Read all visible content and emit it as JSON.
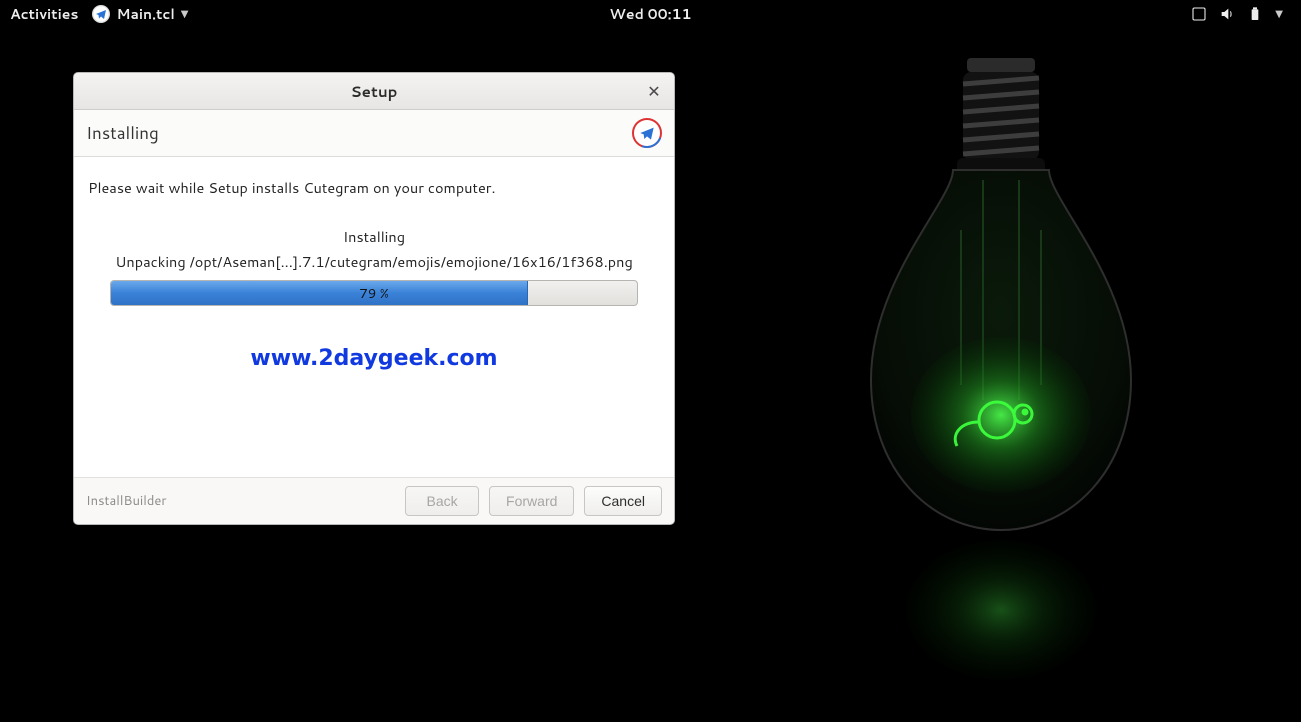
{
  "topbar": {
    "activities": "Activities",
    "app_name": "Main.tcl",
    "clock": "Wed 00:11"
  },
  "window": {
    "title": "Setup",
    "section": "Installing",
    "message": "Please wait while Setup installs Cutegram on your computer.",
    "status_label": "Installing",
    "file_line": "Unpacking /opt/Aseman[...].7.1/cutegram/emojis/emojione/16x16/1f368.png",
    "progress_percent": 79,
    "progress_text": "79 %",
    "watermark": "www.2daygeek.com",
    "brand": "InstallBuilder",
    "buttons": {
      "back": "Back",
      "forward": "Forward",
      "cancel": "Cancel"
    }
  }
}
